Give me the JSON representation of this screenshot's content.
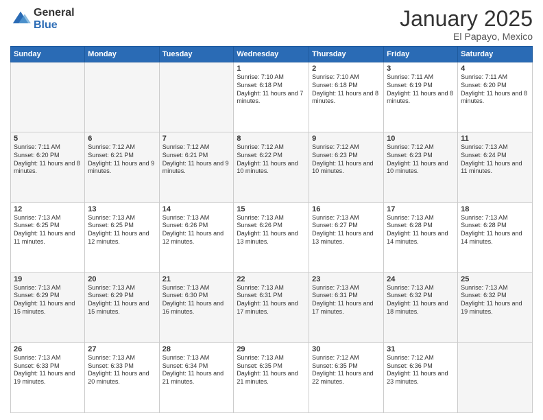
{
  "logo": {
    "general": "General",
    "blue": "Blue"
  },
  "header": {
    "month": "January 2025",
    "location": "El Papayo, Mexico"
  },
  "weekdays": [
    "Sunday",
    "Monday",
    "Tuesday",
    "Wednesday",
    "Thursday",
    "Friday",
    "Saturday"
  ],
  "weeks": [
    [
      {
        "day": "",
        "sunrise": "",
        "sunset": "",
        "daylight": ""
      },
      {
        "day": "",
        "sunrise": "",
        "sunset": "",
        "daylight": ""
      },
      {
        "day": "",
        "sunrise": "",
        "sunset": "",
        "daylight": ""
      },
      {
        "day": "1",
        "sunrise": "Sunrise: 7:10 AM",
        "sunset": "Sunset: 6:18 PM",
        "daylight": "Daylight: 11 hours and 7 minutes."
      },
      {
        "day": "2",
        "sunrise": "Sunrise: 7:10 AM",
        "sunset": "Sunset: 6:18 PM",
        "daylight": "Daylight: 11 hours and 8 minutes."
      },
      {
        "day": "3",
        "sunrise": "Sunrise: 7:11 AM",
        "sunset": "Sunset: 6:19 PM",
        "daylight": "Daylight: 11 hours and 8 minutes."
      },
      {
        "day": "4",
        "sunrise": "Sunrise: 7:11 AM",
        "sunset": "Sunset: 6:20 PM",
        "daylight": "Daylight: 11 hours and 8 minutes."
      }
    ],
    [
      {
        "day": "5",
        "sunrise": "Sunrise: 7:11 AM",
        "sunset": "Sunset: 6:20 PM",
        "daylight": "Daylight: 11 hours and 8 minutes."
      },
      {
        "day": "6",
        "sunrise": "Sunrise: 7:12 AM",
        "sunset": "Sunset: 6:21 PM",
        "daylight": "Daylight: 11 hours and 9 minutes."
      },
      {
        "day": "7",
        "sunrise": "Sunrise: 7:12 AM",
        "sunset": "Sunset: 6:21 PM",
        "daylight": "Daylight: 11 hours and 9 minutes."
      },
      {
        "day": "8",
        "sunrise": "Sunrise: 7:12 AM",
        "sunset": "Sunset: 6:22 PM",
        "daylight": "Daylight: 11 hours and 10 minutes."
      },
      {
        "day": "9",
        "sunrise": "Sunrise: 7:12 AM",
        "sunset": "Sunset: 6:23 PM",
        "daylight": "Daylight: 11 hours and 10 minutes."
      },
      {
        "day": "10",
        "sunrise": "Sunrise: 7:12 AM",
        "sunset": "Sunset: 6:23 PM",
        "daylight": "Daylight: 11 hours and 10 minutes."
      },
      {
        "day": "11",
        "sunrise": "Sunrise: 7:13 AM",
        "sunset": "Sunset: 6:24 PM",
        "daylight": "Daylight: 11 hours and 11 minutes."
      }
    ],
    [
      {
        "day": "12",
        "sunrise": "Sunrise: 7:13 AM",
        "sunset": "Sunset: 6:25 PM",
        "daylight": "Daylight: 11 hours and 11 minutes."
      },
      {
        "day": "13",
        "sunrise": "Sunrise: 7:13 AM",
        "sunset": "Sunset: 6:25 PM",
        "daylight": "Daylight: 11 hours and 12 minutes."
      },
      {
        "day": "14",
        "sunrise": "Sunrise: 7:13 AM",
        "sunset": "Sunset: 6:26 PM",
        "daylight": "Daylight: 11 hours and 12 minutes."
      },
      {
        "day": "15",
        "sunrise": "Sunrise: 7:13 AM",
        "sunset": "Sunset: 6:26 PM",
        "daylight": "Daylight: 11 hours and 13 minutes."
      },
      {
        "day": "16",
        "sunrise": "Sunrise: 7:13 AM",
        "sunset": "Sunset: 6:27 PM",
        "daylight": "Daylight: 11 hours and 13 minutes."
      },
      {
        "day": "17",
        "sunrise": "Sunrise: 7:13 AM",
        "sunset": "Sunset: 6:28 PM",
        "daylight": "Daylight: 11 hours and 14 minutes."
      },
      {
        "day": "18",
        "sunrise": "Sunrise: 7:13 AM",
        "sunset": "Sunset: 6:28 PM",
        "daylight": "Daylight: 11 hours and 14 minutes."
      }
    ],
    [
      {
        "day": "19",
        "sunrise": "Sunrise: 7:13 AM",
        "sunset": "Sunset: 6:29 PM",
        "daylight": "Daylight: 11 hours and 15 minutes."
      },
      {
        "day": "20",
        "sunrise": "Sunrise: 7:13 AM",
        "sunset": "Sunset: 6:29 PM",
        "daylight": "Daylight: 11 hours and 15 minutes."
      },
      {
        "day": "21",
        "sunrise": "Sunrise: 7:13 AM",
        "sunset": "Sunset: 6:30 PM",
        "daylight": "Daylight: 11 hours and 16 minutes."
      },
      {
        "day": "22",
        "sunrise": "Sunrise: 7:13 AM",
        "sunset": "Sunset: 6:31 PM",
        "daylight": "Daylight: 11 hours and 17 minutes."
      },
      {
        "day": "23",
        "sunrise": "Sunrise: 7:13 AM",
        "sunset": "Sunset: 6:31 PM",
        "daylight": "Daylight: 11 hours and 17 minutes."
      },
      {
        "day": "24",
        "sunrise": "Sunrise: 7:13 AM",
        "sunset": "Sunset: 6:32 PM",
        "daylight": "Daylight: 11 hours and 18 minutes."
      },
      {
        "day": "25",
        "sunrise": "Sunrise: 7:13 AM",
        "sunset": "Sunset: 6:32 PM",
        "daylight": "Daylight: 11 hours and 19 minutes."
      }
    ],
    [
      {
        "day": "26",
        "sunrise": "Sunrise: 7:13 AM",
        "sunset": "Sunset: 6:33 PM",
        "daylight": "Daylight: 11 hours and 19 minutes."
      },
      {
        "day": "27",
        "sunrise": "Sunrise: 7:13 AM",
        "sunset": "Sunset: 6:33 PM",
        "daylight": "Daylight: 11 hours and 20 minutes."
      },
      {
        "day": "28",
        "sunrise": "Sunrise: 7:13 AM",
        "sunset": "Sunset: 6:34 PM",
        "daylight": "Daylight: 11 hours and 21 minutes."
      },
      {
        "day": "29",
        "sunrise": "Sunrise: 7:13 AM",
        "sunset": "Sunset: 6:35 PM",
        "daylight": "Daylight: 11 hours and 21 minutes."
      },
      {
        "day": "30",
        "sunrise": "Sunrise: 7:12 AM",
        "sunset": "Sunset: 6:35 PM",
        "daylight": "Daylight: 11 hours and 22 minutes."
      },
      {
        "day": "31",
        "sunrise": "Sunrise: 7:12 AM",
        "sunset": "Sunset: 6:36 PM",
        "daylight": "Daylight: 11 hours and 23 minutes."
      },
      {
        "day": "",
        "sunrise": "",
        "sunset": "",
        "daylight": ""
      }
    ]
  ]
}
